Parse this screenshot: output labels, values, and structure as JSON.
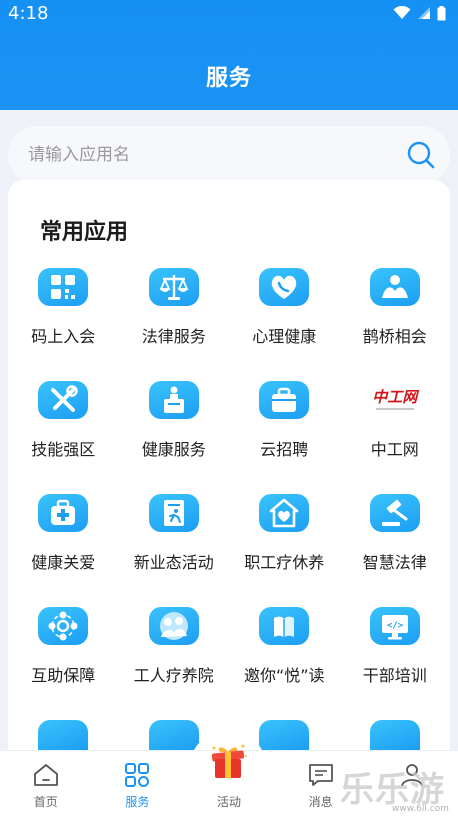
{
  "status_bar": {
    "time": "4:18"
  },
  "header": {
    "title": "服务"
  },
  "search": {
    "placeholder": "请输入应用名"
  },
  "section": {
    "title": "常用应用"
  },
  "apps": [
    {
      "label": "码上入会",
      "icon": "qr-grid-icon"
    },
    {
      "label": "法律服务",
      "icon": "scales-icon"
    },
    {
      "label": "心理健康",
      "icon": "heart-phone-icon"
    },
    {
      "label": "鹊桥相会",
      "icon": "couple-icon"
    },
    {
      "label": "技能强区",
      "icon": "tools-icon"
    },
    {
      "label": "健康服务",
      "icon": "medicine-icon"
    },
    {
      "label": "云招聘",
      "icon": "briefcase-icon"
    },
    {
      "label": "中工网",
      "icon": "zhonggongwang-logo"
    },
    {
      "label": "健康关爱",
      "icon": "first-aid-icon"
    },
    {
      "label": "新业态活动",
      "icon": "document-runner-icon"
    },
    {
      "label": "职工疗休养",
      "icon": "home-heart-icon"
    },
    {
      "label": "智慧法律",
      "icon": "gavel-icon"
    },
    {
      "label": "互助保障",
      "icon": "people-circle-icon"
    },
    {
      "label": "工人疗养院",
      "icon": "group-photo-icon"
    },
    {
      "label": "邀你“悦”读",
      "icon": "book-icon"
    },
    {
      "label": "干部培训",
      "icon": "monitor-code-icon"
    }
  ],
  "logo_text": "中工网",
  "tabs": [
    {
      "label": "首页",
      "icon": "home-icon",
      "active": false
    },
    {
      "label": "服务",
      "icon": "grid-icon",
      "active": true
    },
    {
      "label": "活动",
      "icon": "gift-icon",
      "active": false
    },
    {
      "label": "消息",
      "icon": "message-icon",
      "active": false
    },
    {
      "label": "",
      "icon": "person-icon",
      "active": false
    }
  ],
  "watermark": {
    "text": "乐乐游戏",
    "sub": "www.6ll.com"
  },
  "colors": {
    "primary": "#1b93f5",
    "icon_gradient_start": "#3ac3fb",
    "icon_gradient_end": "#1c9ef3",
    "logo_red": "#d0161b"
  }
}
